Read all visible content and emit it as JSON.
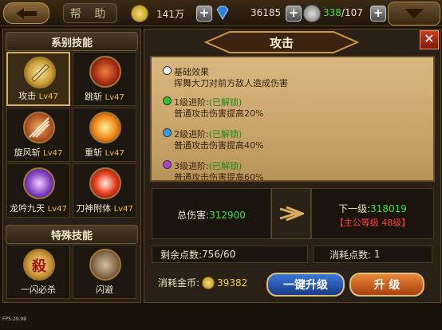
{
  "topbar": {
    "help_label": "帮 助",
    "gold_amount": "141万",
    "diamond_amount": "36185",
    "stamina_current": "338",
    "stamina_max": "/107"
  },
  "left_panel": {
    "series_header": "系别技能",
    "special_header": "特殊技能",
    "series_skills": [
      {
        "name": "攻击",
        "level": "Lv47"
      },
      {
        "name": "跳斩",
        "level": "Lv47"
      },
      {
        "name": "旋风斩",
        "level": "Lv47"
      },
      {
        "name": "重斩",
        "level": "Lv47"
      },
      {
        "name": "龙吟九天",
        "level": "Lv47"
      },
      {
        "name": "刀神附体",
        "level": "Lv47"
      }
    ],
    "special_skills": [
      {
        "name": "一闪必杀",
        "glyph": "殺"
      },
      {
        "name": "闪避"
      }
    ]
  },
  "detail": {
    "title": "攻击",
    "effects": [
      {
        "title": "基础效果",
        "status": "",
        "desc": "挥舞大刀对前方敌人造成伤害",
        "color": "#ffffff"
      },
      {
        "title": "1级进阶:",
        "status": "(已解锁)",
        "desc": "普通攻击伤害提高20%",
        "color": "#30c030"
      },
      {
        "title": "2级进阶:",
        "status": "(已解锁)",
        "desc": "普通攻击伤害提高40%",
        "color": "#30a0e0"
      },
      {
        "title": "3级进阶:",
        "status": "(已解锁)",
        "desc": "普通攻击伤害提高60%",
        "color": "#b040d0"
      }
    ],
    "total_damage_label": "总伤害:",
    "total_damage_value": "312900",
    "next_level_label": "下一级:",
    "next_level_value": "318019",
    "requirement": "【主公等级 48级】",
    "remaining_points_label": "剩余点数:",
    "remaining_points_value": "756/60",
    "cost_points_label": "消耗点数:",
    "cost_points_value": "1",
    "gold_cost_label": "消耗金币:",
    "gold_cost_value": "39382",
    "one_click_upgrade": "一键升级",
    "upgrade": "升  级"
  },
  "fps_text": "FPS:29.99",
  "colors": {
    "accent_gold": "#f0c040",
    "green_value": "#40e040",
    "red_requirement": "#ff4040"
  }
}
